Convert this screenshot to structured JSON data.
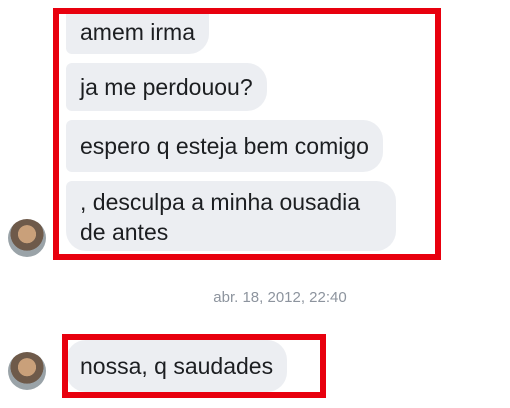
{
  "conversation": {
    "messages": [
      {
        "text": "amem irma"
      },
      {
        "text": "ja me perdouou?"
      },
      {
        "text": "espero q esteja bem comigo"
      },
      {
        "text": ", desculpa a minha ousadia de antes"
      }
    ],
    "timestamp": "abr. 18, 2012, 22:40",
    "later_message": {
      "text": "nossa, q saudades"
    }
  },
  "colors": {
    "bubble": "#eceef2",
    "highlight": "#e8000e",
    "timestamp": "#8d949e"
  }
}
